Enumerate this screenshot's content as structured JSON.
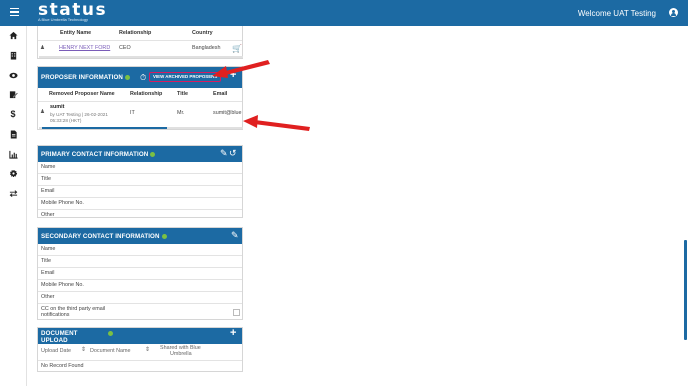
{
  "app": {
    "logo": "status",
    "tagline": "A Blue Umbrella Technology",
    "welcome": "Welcome UAT Testing"
  },
  "sidebar": {
    "icons": [
      "menu-icon",
      "home-icon",
      "building-icon",
      "eye-icon",
      "edit-document-icon",
      "dollar-icon",
      "document-icon",
      "chart-icon",
      "gear-icon",
      "transfer-icon"
    ]
  },
  "entity_table": {
    "headers": [
      "Entity Name",
      "Relationship",
      "Country"
    ],
    "row": {
      "name": "HENRY NEXT FORD",
      "relationship": "CEO",
      "country": "Bangladesh"
    }
  },
  "proposer": {
    "title": "PROPOSER INFORMATION",
    "archived_button": "VIEW ARCHIVED PROPOSERS",
    "headers": [
      "Removed Proposer Name",
      "Relationship",
      "Title",
      "Email"
    ],
    "row": {
      "name": "sumit",
      "by": "by UAT Testing | 26-02-2021",
      "time": "05:33:28 (HKT)",
      "relationship": "IT",
      "title": "Mr.",
      "email": "sumit@blue"
    }
  },
  "primary_contact": {
    "title": "PRIMARY CONTACT INFORMATION",
    "fields": [
      "Name",
      "Title",
      "Email",
      "Mobile Phone No.",
      "Other"
    ]
  },
  "secondary_contact": {
    "title": "SECONDARY CONTACT INFORMATION",
    "fields": [
      "Name",
      "Title",
      "Email",
      "Mobile Phone No.",
      "Other"
    ],
    "cc_label_1": "CC on the third party email",
    "cc_label_2": "notifications"
  },
  "document_upload": {
    "title_1": "DOCUMENT",
    "title_2": "UPLOAD",
    "headers": [
      "Upload Date",
      "Document Name",
      "Shared with Blue",
      "Umbrella"
    ],
    "empty": "No Record Found"
  },
  "colors": {
    "primary": "#1c6aa3",
    "accent": "#d81b60",
    "info": "#7bc043"
  }
}
